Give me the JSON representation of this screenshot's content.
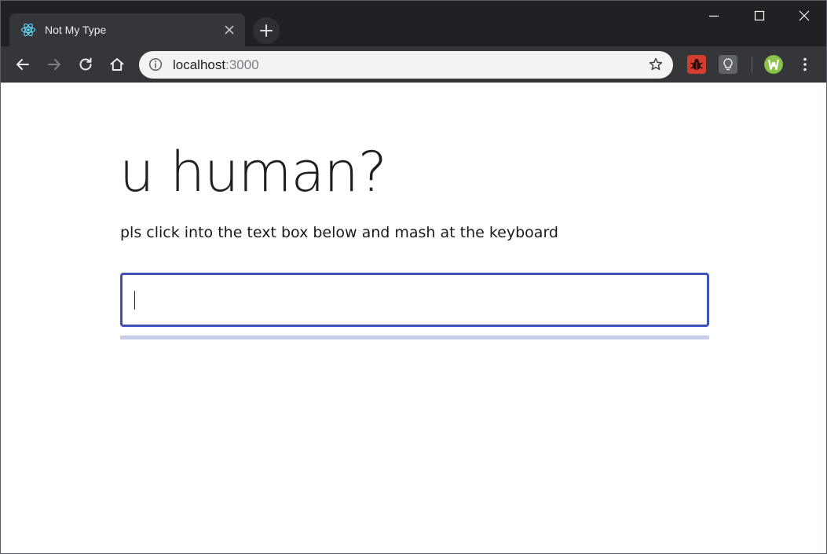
{
  "browser": {
    "tab": {
      "title": "Not My Type",
      "favicon": "react-atom-icon"
    },
    "address": {
      "host": "localhost",
      "port": ":3000"
    },
    "colors": {
      "frame": "#202124",
      "toolbar": "#35363a",
      "omnibox": "#f1f3f4"
    }
  },
  "page": {
    "heading": "u human?",
    "instruction": "pls click into the text box below and mash at the keyboard",
    "input": {
      "value": "",
      "placeholder": ""
    },
    "progress": 0,
    "colors": {
      "accent": "#3f51b5",
      "track": "#c7cce8"
    }
  }
}
